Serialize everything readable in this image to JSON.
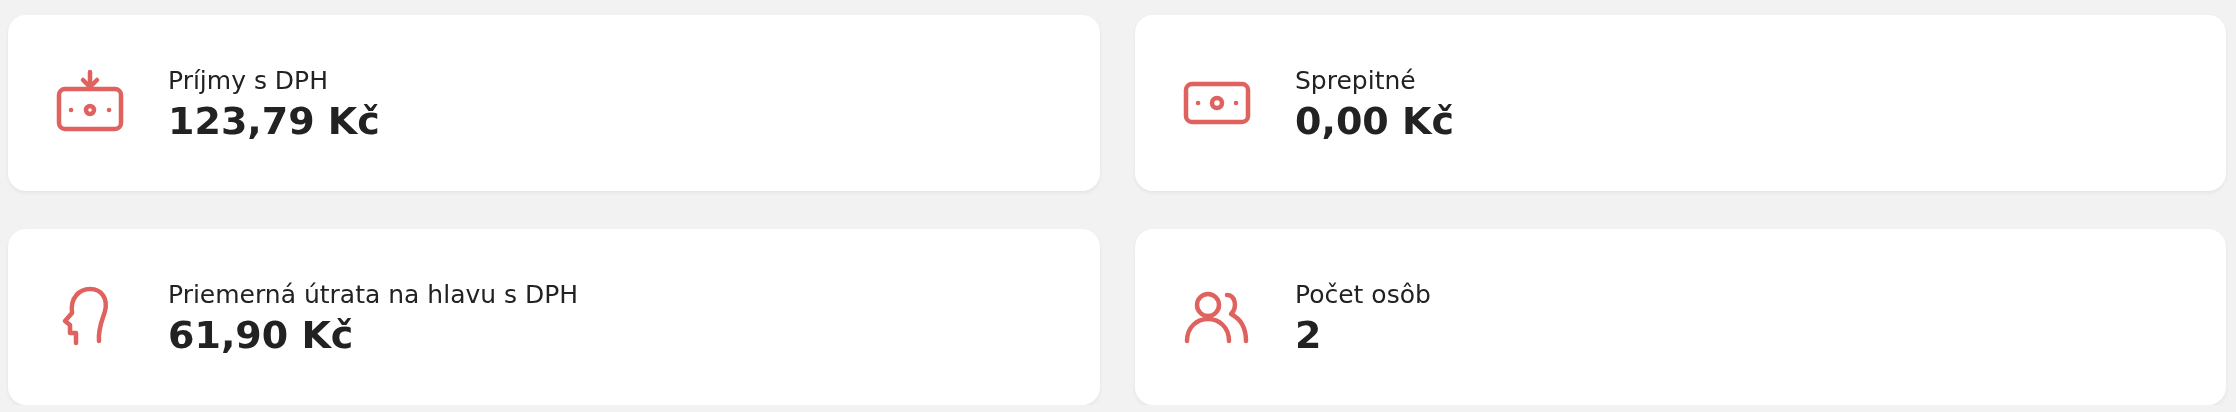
{
  "cards": [
    {
      "kind": "income",
      "label": "Príjmy s DPH",
      "value": "123,79 Kč"
    },
    {
      "kind": "tip",
      "label": "Sprepitné",
      "value": "0,00 Kč"
    },
    {
      "kind": "per-head",
      "label": "Priemerná útrata na hlavu s DPH",
      "value": "61,90 Kč"
    },
    {
      "kind": "people",
      "label": "Počet osôb",
      "value": "2"
    }
  ]
}
